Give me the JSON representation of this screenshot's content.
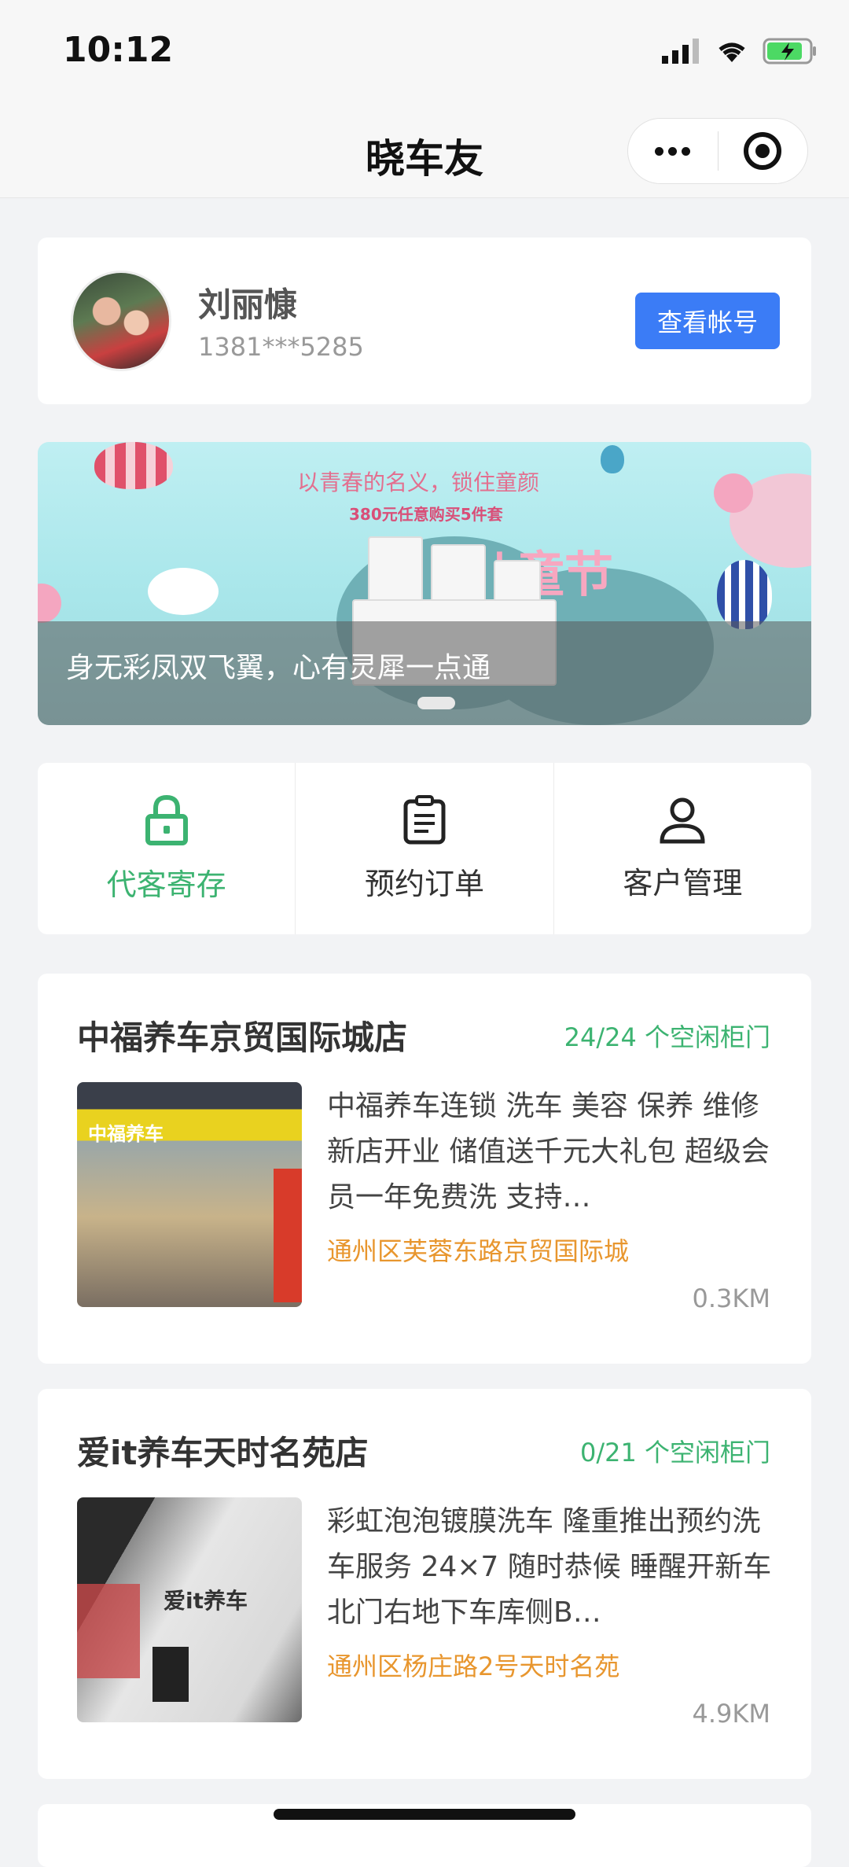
{
  "status": {
    "time": "10:12"
  },
  "navbar": {
    "title": "晓车友"
  },
  "profile": {
    "name": "刘丽慷",
    "phone": "1381***5285",
    "button_label": "查看帐号"
  },
  "banner": {
    "headline": "以青春的名义，锁住童颜",
    "subline": "380元任意购买5件套",
    "badge": "儿童节",
    "caption": "身无彩凤双飞翼，心有灵犀一点通"
  },
  "menu": {
    "items": [
      {
        "label": "代客寄存",
        "icon": "lock-icon",
        "active": true
      },
      {
        "label": "预约订单",
        "icon": "clipboard-icon",
        "active": false
      },
      {
        "label": "客户管理",
        "icon": "user-icon",
        "active": false
      }
    ]
  },
  "stores": [
    {
      "name": "中福养车京贸国际城店",
      "lockers": "24/24 个空闲柜门",
      "description": "中福养车连锁 洗车 美容 保养 维修 新店开业 储值送千元大礼包 超级会员一年免费洗 支持…",
      "address": "通州区芙蓉东路京贸国际城",
      "distance": "0.3KM",
      "sign_text": "中福养车"
    },
    {
      "name": "爱it养车天时名苑店",
      "lockers": "0/21 个空闲柜门",
      "description": "彩虹泡泡镀膜洗车 隆重推出预约洗车服务 24×7 随时恭候 睡醒开新车 北门右地下车库侧B…",
      "address": "通州区杨庄路2号天时名苑",
      "distance": "4.9KM",
      "sign_text": "爱it养车"
    }
  ],
  "colors": {
    "accent": "#3cb371",
    "primary_button": "#3b7cf6",
    "address": "#e8962e"
  }
}
